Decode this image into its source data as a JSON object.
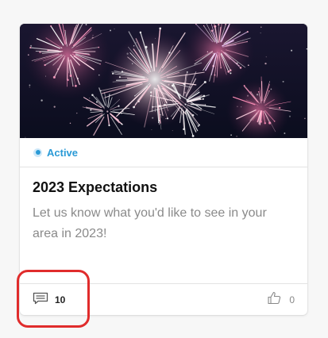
{
  "card": {
    "status_label": "Active",
    "title": "2023 Expectations",
    "description": "Let us know what you'd like to see in your area in 2023!",
    "comments_count": "10",
    "likes_count": "0",
    "hero_image": "fireworks-night-sky",
    "icons": {
      "status": "status-dot-icon",
      "comments": "comment-icon",
      "likes": "thumbs-up-icon"
    }
  },
  "colors": {
    "accent": "#2a9ad6",
    "highlight": "#e02c2c"
  }
}
